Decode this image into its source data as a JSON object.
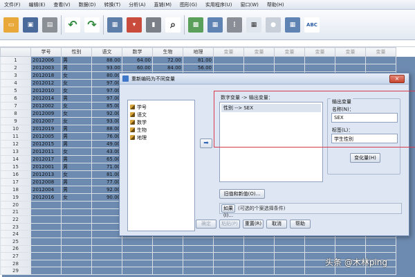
{
  "menubar": {
    "items": [
      "文件(F)",
      "编辑(E)",
      "查看(V)",
      "数据(D)",
      "转换(T)",
      "分析(A)",
      "直销(M)",
      "图形(G)",
      "实用程序(U)",
      "窗口(W)",
      "帮助(H)"
    ]
  },
  "toolbar": {
    "icons": [
      "open-icon",
      "save-icon",
      "print-icon",
      "dialog-recall-icon",
      "undo-icon",
      "redo-icon",
      "goto-case-icon",
      "goto-variable-icon",
      "variables-icon",
      "split-file-icon",
      "find-icon",
      "chart-builder-icon",
      "table-icon",
      "select-cases-icon",
      "value-labels-icon",
      "visibility-icon",
      "spell-check-icon"
    ],
    "spell_label": "ABC"
  },
  "grid": {
    "columns": [
      "学号",
      "性别",
      "语文",
      "数学",
      "生物",
      "地理",
      "变量",
      "变量",
      "变量",
      "变量",
      "变量",
      "变量"
    ],
    "rows": [
      [
        "1",
        "2012006",
        "男",
        "88.00",
        "64.00",
        "72.00",
        "81.00"
      ],
      [
        "2",
        "2012003",
        "男",
        "93.00",
        "60.00",
        "84.00",
        "56.00"
      ],
      [
        "3",
        "2012018",
        "女",
        "80.00",
        "",
        "",
        ""
      ],
      [
        "4",
        "2012012",
        "女",
        "97.00",
        "",
        "",
        ""
      ],
      [
        "5",
        "2012010",
        "女",
        "97.00",
        "",
        "",
        ""
      ],
      [
        "6",
        "2012014",
        "男",
        "97.00",
        "",
        "",
        ""
      ],
      [
        "7",
        "2012002",
        "女",
        "85.00",
        "",
        "",
        ""
      ],
      [
        "8",
        "2012009",
        "女",
        "92.00",
        "",
        "",
        ""
      ],
      [
        "9",
        "2012007",
        "女",
        "93.00",
        "",
        "",
        ""
      ],
      [
        "10",
        "2012019",
        "男",
        "88.00",
        "",
        "",
        ""
      ],
      [
        "11",
        "2012005",
        "男",
        "76.00",
        "",
        "",
        ""
      ],
      [
        "12",
        "2012015",
        "男",
        "49.00",
        "",
        "",
        ""
      ],
      [
        "13",
        "2012011",
        "女",
        "43.00",
        "",
        "",
        ""
      ],
      [
        "14",
        "2012017",
        "男",
        "65.00",
        "",
        "",
        ""
      ],
      [
        "15",
        "2012001",
        "男",
        "71.00",
        "",
        "",
        ""
      ],
      [
        "16",
        "2012013",
        "女",
        "81.00",
        "",
        "",
        ""
      ],
      [
        "17",
        "2012008",
        "男",
        "77.00",
        "",
        "",
        ""
      ],
      [
        "18",
        "2012004",
        "男",
        "92.00",
        "",
        "",
        ""
      ],
      [
        "19",
        "2012016",
        "女",
        "90.00",
        "",
        "",
        ""
      ],
      [
        "20",
        "",
        "",
        "",
        "",
        "",
        ""
      ],
      [
        "21",
        "",
        "",
        "",
        "",
        "",
        ""
      ],
      [
        "22",
        "",
        "",
        "",
        "",
        "",
        ""
      ],
      [
        "23",
        "",
        "",
        "",
        "",
        "",
        ""
      ],
      [
        "24",
        "",
        "",
        "",
        "",
        "",
        ""
      ],
      [
        "25",
        "",
        "",
        "",
        "",
        "",
        ""
      ],
      [
        "26",
        "",
        "",
        "",
        "",
        "",
        ""
      ],
      [
        "27",
        "",
        "",
        "",
        "",
        "",
        ""
      ],
      [
        "28",
        "",
        "",
        "",
        "",
        "",
        ""
      ],
      [
        "29",
        "",
        "",
        "",
        "",
        "",
        ""
      ]
    ]
  },
  "dialog": {
    "title": "重新编码为不同变量",
    "close_label": "×",
    "source_vars": [
      "学号",
      "语文",
      "数学",
      "生物",
      "地理"
    ],
    "mapping_label": "数字变量 -> 输出变量：",
    "mapping_items": [
      "性别 --> SEX"
    ],
    "output_legend": "输出变量",
    "name_label": "名称(N)：",
    "name_value": "SEX",
    "label_label": "标签(L)：",
    "label_value": "学生性别",
    "change_button": "变化量(H)",
    "old_new_button": "旧值和新值(O)...",
    "if_button": "如果(I)...",
    "if_text": "(可选的个案选择条件)",
    "buttons": [
      {
        "label": "确定",
        "enabled": false
      },
      {
        "label": "粘贴(P)",
        "enabled": false
      },
      {
        "label": "重置(R)",
        "enabled": true
      },
      {
        "label": "取消",
        "enabled": true
      },
      {
        "label": "帮助",
        "enabled": true
      }
    ]
  },
  "watermark": "头条 @木林ping"
}
